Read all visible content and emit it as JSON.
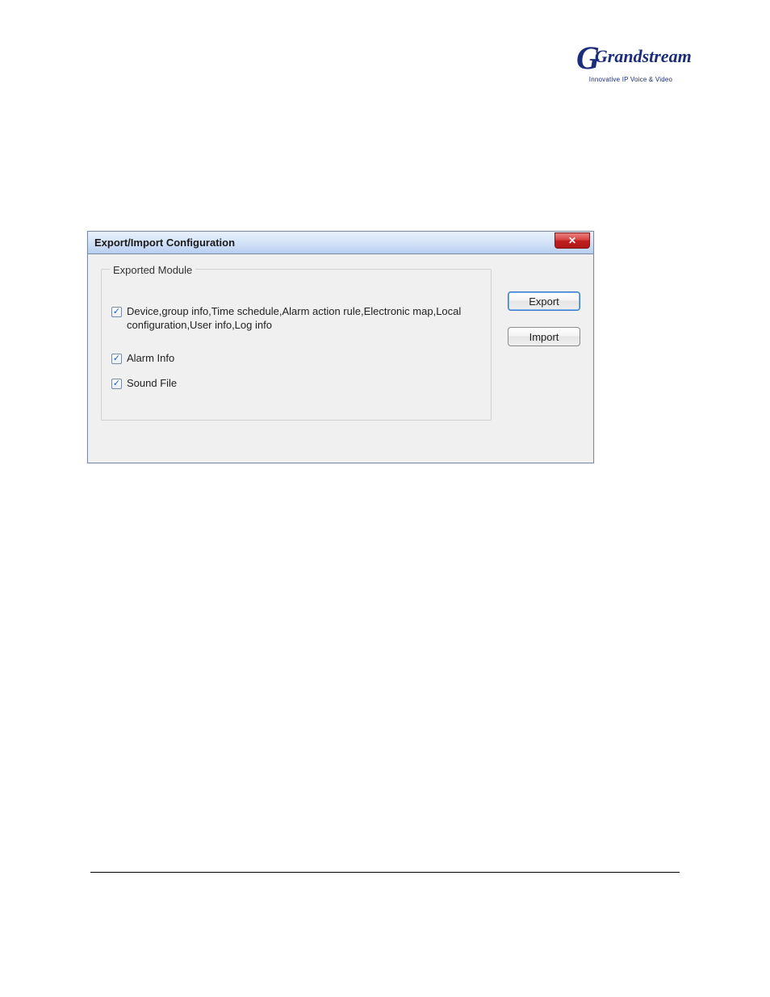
{
  "brand": {
    "name": "Grandstream",
    "tagline": "Innovative IP Voice & Video"
  },
  "dialog": {
    "title": "Export/Import Configuration",
    "close_glyph": "✕",
    "groupbox_title": "Exported Module",
    "checkboxes": [
      {
        "label": "Device,group info,Time schedule,Alarm action rule,Electronic map,Local configuration,User info,Log info",
        "checked": true
      },
      {
        "label": "Alarm Info",
        "checked": true
      },
      {
        "label": "Sound File",
        "checked": true
      }
    ],
    "buttons": {
      "export_label": "Export",
      "import_label": "Import"
    },
    "check_glyph": "✓"
  }
}
